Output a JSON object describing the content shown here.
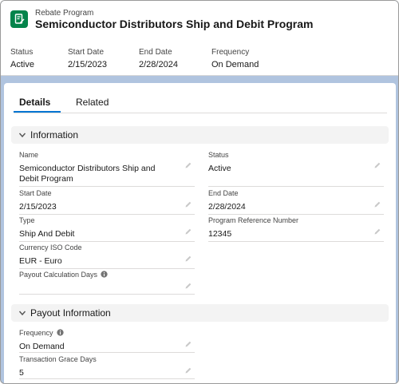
{
  "header": {
    "object_label": "Rebate Program",
    "title": "Semiconductor Distributors Ship and Debit Program",
    "highlights": [
      {
        "label": "Status",
        "value": "Active"
      },
      {
        "label": "Start Date",
        "value": "2/15/2023"
      },
      {
        "label": "End Date",
        "value": "2/28/2024"
      },
      {
        "label": "Frequency",
        "value": "On Demand"
      }
    ]
  },
  "tabs": [
    {
      "label": "Details"
    },
    {
      "label": "Related"
    }
  ],
  "sections": [
    {
      "title": "Information",
      "fields": [
        {
          "label": "Name",
          "value": "Semiconductor Distributors Ship and Debit Program"
        },
        {
          "label": "Status",
          "value": "Active"
        },
        {
          "label": "Start Date",
          "value": "2/15/2023"
        },
        {
          "label": "End Date",
          "value": "2/28/2024"
        },
        {
          "label": "Type",
          "value": "Ship And Debit"
        },
        {
          "label": "Program Reference Number",
          "value": "12345"
        },
        {
          "label": "Currency ISO Code",
          "value": "EUR - Euro"
        },
        {
          "label": "Payout Calculation Days",
          "value": ""
        }
      ]
    },
    {
      "title": "Payout Information",
      "fields": [
        {
          "label": "Frequency",
          "value": "On Demand"
        },
        {
          "label": "Transaction Grace Days",
          "value": "5"
        }
      ]
    }
  ],
  "colors": {
    "brand_icon": "#04844b",
    "active_tab": "#0176d3",
    "page_background": "#b0c4df",
    "section_header": "#f3f3f3"
  }
}
